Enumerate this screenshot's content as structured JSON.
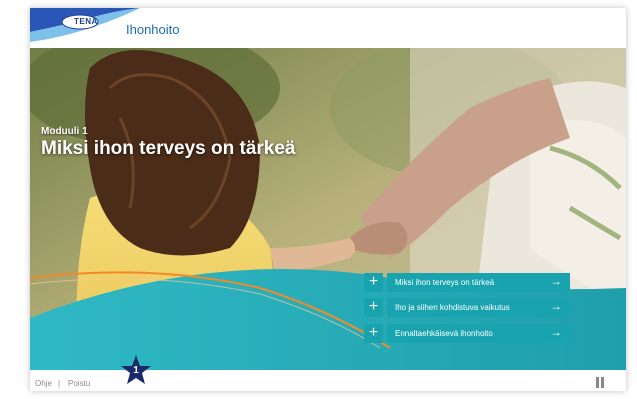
{
  "header": {
    "logo_text": "TENA",
    "app_title": "Ihonhoito"
  },
  "hero": {
    "module_label": "Moduuli 1",
    "module_title": "Miksi ihon terveys on tärkeä"
  },
  "menu": {
    "items": [
      {
        "label": "Miksi ihon terveys on tärkeä",
        "icon": "plus-icon",
        "arrow": "→"
      },
      {
        "label": "Iho ja siihen kohdistuva vaikutus",
        "icon": "plus-icon",
        "arrow": "→"
      },
      {
        "label": "Ennaltaehkäisevä ihonhoito",
        "icon": "plus-icon",
        "arrow": "→"
      }
    ],
    "plus_glyph": "+"
  },
  "footer": {
    "help_label": "Ohje",
    "separator": "|",
    "exit_label": "Poistu"
  },
  "progress": {
    "current_module": "1"
  },
  "colors": {
    "brand_blue": "#1b3d94",
    "title_blue": "#1b6bb5",
    "teal": "#19a3ae",
    "star_navy": "#1b2a6b",
    "orange_line": "#f08a2a"
  }
}
